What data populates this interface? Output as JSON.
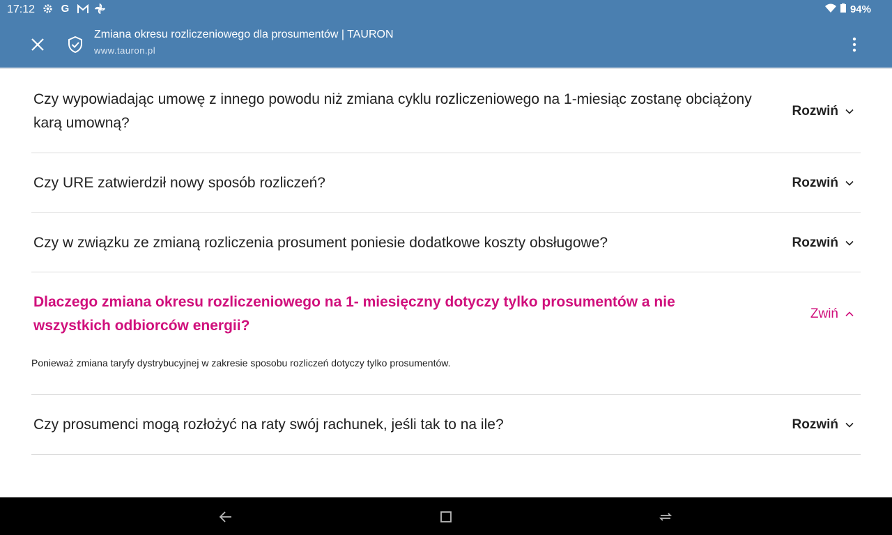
{
  "status": {
    "time": "17:12",
    "left_icons": [
      "gear-icon",
      "google-g-icon",
      "gmail-icon",
      "pinwheel-icon"
    ],
    "battery": "94%"
  },
  "appbar": {
    "title": "Zmiana okresu rozliczeniowego dla prosumentów | TAURON",
    "url": "www.tauron.pl"
  },
  "faq": [
    {
      "question": "Czy wypowiadając umowę z innego powodu niż zmiana cyklu rozliczeniowego na 1-miesiąc zostanę obciążony karą umowną?",
      "toggle": "Rozwiń",
      "open": false
    },
    {
      "question": "Czy URE zatwierdził nowy sposób rozliczeń?",
      "toggle": "Rozwiń",
      "open": false
    },
    {
      "question": "Czy w związku ze zmianą rozliczenia prosument poniesie dodatkowe koszty obsługowe?",
      "toggle": "Rozwiń",
      "open": false
    },
    {
      "question": "Dlaczego zmiana okresu rozliczeniowego na 1- miesięczny dotyczy tylko prosumentów a nie wszystkich odbiorców energii?",
      "toggle": "Zwiń",
      "open": true,
      "answer": "Ponieważ zmiana taryfy dystrybucyjnej w zakresie sposobu rozliczeń dotyczy tylko prosumentów."
    },
    {
      "question": "Czy prosumenci mogą rozłożyć na raty swój rachunek, jeśli tak to na ile?",
      "toggle": "Rozwiń",
      "open": false
    }
  ],
  "colors": {
    "appbar": "#4a7fb0",
    "accent": "#d0107c",
    "text": "#222222",
    "divider": "#dcdcdc"
  }
}
